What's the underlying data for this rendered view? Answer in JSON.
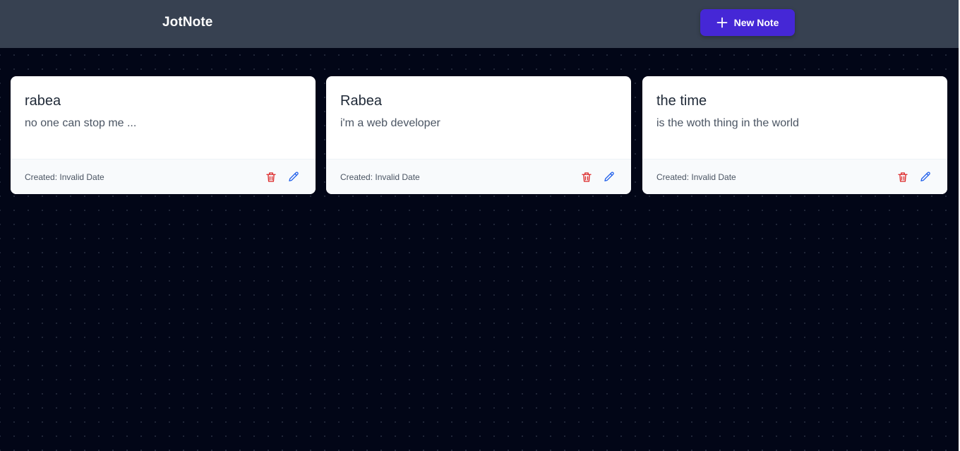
{
  "header": {
    "brand": "JotNote",
    "new_note_label": "New Note",
    "background": "#374151",
    "accent": "#4527d6"
  },
  "page": {
    "background": "#020617"
  },
  "notes": [
    {
      "title": "rabea",
      "content": "no one can stop me ...",
      "created": "Created: Invalid Date"
    },
    {
      "title": "Rabea",
      "content": "i'm a web developer",
      "created": "Created: Invalid Date"
    },
    {
      "title": "the time",
      "content": "is the woth thing in the world",
      "created": "Created: Invalid Date"
    }
  ],
  "icons": {
    "add": "plus-icon",
    "delete": "trash-icon",
    "edit": "pencil-icon"
  },
  "colors": {
    "delete": "#dc2626",
    "edit": "#2563eb"
  }
}
